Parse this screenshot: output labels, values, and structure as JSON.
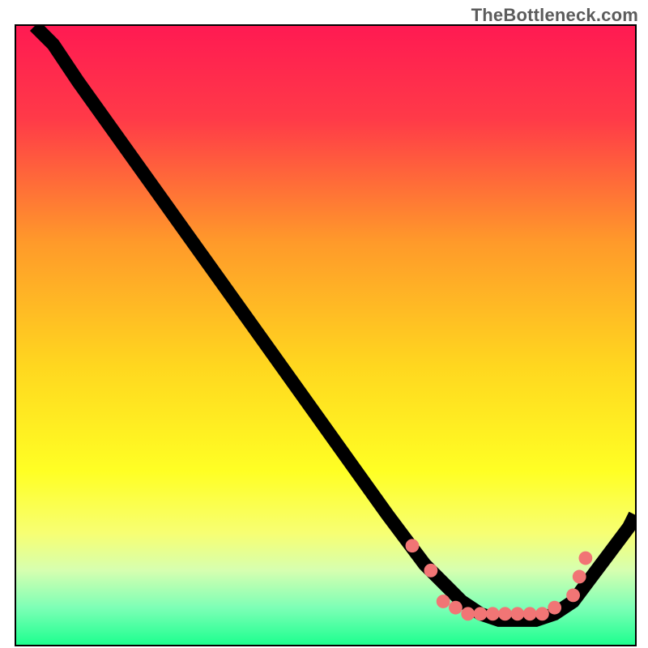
{
  "watermark": {
    "text": "TheBottleneck.com"
  },
  "chart_data": {
    "type": "line",
    "title": "",
    "xlabel": "",
    "ylabel": "",
    "xlim": [
      0,
      100
    ],
    "ylim": [
      0,
      100
    ],
    "background_gradient": {
      "stops": [
        {
          "offset": 0.0,
          "color": "#ff1a52"
        },
        {
          "offset": 0.15,
          "color": "#ff3a48"
        },
        {
          "offset": 0.35,
          "color": "#ff9a2a"
        },
        {
          "offset": 0.55,
          "color": "#ffd71f"
        },
        {
          "offset": 0.72,
          "color": "#ffff24"
        },
        {
          "offset": 0.82,
          "color": "#f7ff73"
        },
        {
          "offset": 0.88,
          "color": "#d6ffb0"
        },
        {
          "offset": 0.94,
          "color": "#7dffb6"
        },
        {
          "offset": 1.0,
          "color": "#1dff8f"
        }
      ]
    },
    "series": [
      {
        "name": "curve",
        "x": [
          3,
          6,
          10,
          15,
          20,
          25,
          30,
          35,
          40,
          45,
          50,
          55,
          60,
          63,
          66,
          69,
          72,
          75,
          78,
          81,
          84,
          87,
          90,
          93,
          96,
          99,
          100
        ],
        "y": [
          100,
          97,
          91,
          84,
          77,
          70,
          63,
          56,
          49,
          42,
          35,
          28,
          21,
          17,
          13,
          10,
          7,
          5,
          4,
          4,
          4,
          5,
          7,
          11,
          15,
          19,
          21
        ]
      }
    ],
    "points": [
      {
        "x": 64,
        "y": 16
      },
      {
        "x": 67,
        "y": 12
      },
      {
        "x": 69,
        "y": 7
      },
      {
        "x": 71,
        "y": 6
      },
      {
        "x": 73,
        "y": 5
      },
      {
        "x": 75,
        "y": 5
      },
      {
        "x": 77,
        "y": 5
      },
      {
        "x": 79,
        "y": 5
      },
      {
        "x": 81,
        "y": 5
      },
      {
        "x": 83,
        "y": 5
      },
      {
        "x": 85,
        "y": 5
      },
      {
        "x": 87,
        "y": 6
      },
      {
        "x": 90,
        "y": 8
      },
      {
        "x": 91,
        "y": 11
      },
      {
        "x": 92,
        "y": 14
      }
    ]
  }
}
